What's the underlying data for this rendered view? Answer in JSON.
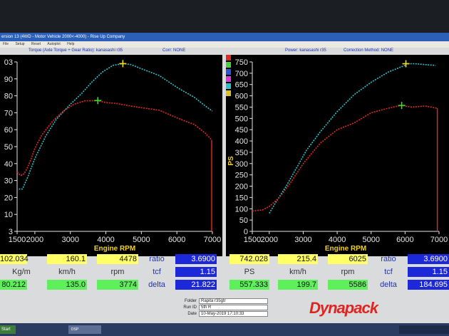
{
  "window": {
    "title": "ersion 13 (4WD - Motor Vehicle 2000<-4000) - Rise Up Company"
  },
  "menu": [
    "File",
    "Setup",
    "Reset",
    "Autoplot",
    "Help"
  ],
  "left_header": {
    "title": "Torque (Axle Torque + Gear Ratio): kanasashi r35",
    "corr": "Corr: NONE"
  },
  "right_header": {
    "title": "Power: kanasashi r35",
    "corr": "Correction Method: NONE"
  },
  "colors": {
    "red_curve": "#e02a24",
    "cyan_curve": "#2fbfc8",
    "marker_yellow": "#f4e214",
    "marker_green": "#38e21f"
  },
  "chart_data": [
    {
      "type": "line",
      "xlabel": "Engine RPM",
      "ylabel": "",
      "x_ticks": [
        "1500",
        "2000",
        "3000",
        "4000",
        "5000",
        "6000",
        "7000"
      ],
      "y_ticks": [
        "3",
        "10",
        "20",
        "30",
        "40",
        "50",
        "60",
        "70",
        "80",
        "90",
        "03"
      ],
      "xlim": [
        1500,
        7000
      ],
      "ylim": [
        3,
        103
      ],
      "series": [
        {
          "color": "cyan",
          "x": [
            1550,
            1650,
            1800,
            2000,
            2300,
            2600,
            3000,
            3300,
            3600,
            3900,
            4200,
            4478,
            4700,
            5000,
            5500,
            6000,
            6500,
            6800,
            7000
          ],
          "y": [
            28,
            28,
            35,
            46,
            59,
            69,
            78,
            84,
            91,
            97,
            101,
            102,
            101.5,
            99,
            95,
            88,
            82,
            77,
            74
          ]
        },
        {
          "color": "red",
          "x": [
            1500,
            1600,
            1700,
            1800,
            1900,
            2000,
            2200,
            2500,
            2800,
            3100,
            3400,
            3774,
            4000,
            4300,
            4700,
            5000,
            5500,
            6000,
            6500,
            6800,
            6980
          ],
          "y": [
            38,
            36,
            37,
            41,
            46,
            52,
            60,
            68,
            74,
            78,
            80,
            80.2,
            79,
            78.5,
            77,
            76,
            74.5,
            70,
            66,
            61,
            57
          ]
        }
      ],
      "markers": [
        {
          "color": "yellow",
          "x": 4478,
          "y": 102.0
        },
        {
          "color": "green",
          "x": 3774,
          "y": 80.2
        }
      ]
    },
    {
      "type": "line",
      "xlabel": "Engine RPM",
      "ylabel": "PS",
      "x_ticks": [
        "1500",
        "2000",
        "3000",
        "4000",
        "5000",
        "6000",
        "7000"
      ],
      "y_ticks": [
        "0",
        "50",
        "100",
        "150",
        "200",
        "250",
        "300",
        "350",
        "400",
        "450",
        "500",
        "550",
        "600",
        "650",
        "700",
        "750"
      ],
      "xlim": [
        1500,
        7000
      ],
      "ylim": [
        0,
        750
      ],
      "series": [
        {
          "color": "cyan",
          "x": [
            2000,
            2200,
            2500,
            2800,
            3100,
            3500,
            4000,
            4500,
            5000,
            5500,
            6000,
            6025,
            6300,
            6600,
            6900
          ],
          "y": [
            80,
            130,
            200,
            280,
            360,
            440,
            530,
            605,
            660,
            705,
            735,
            742,
            742,
            738,
            735
          ]
        },
        {
          "color": "red",
          "x": [
            1500,
            1800,
            2000,
            2300,
            2600,
            3000,
            3500,
            4000,
            4500,
            5000,
            5500,
            5800,
            5900,
            6200,
            6600,
            6950
          ],
          "y": [
            90,
            95,
            110,
            150,
            210,
            300,
            390,
            450,
            480,
            525,
            545,
            555,
            557,
            550,
            555,
            545
          ]
        }
      ],
      "markers": [
        {
          "color": "yellow",
          "x": 6025,
          "y": 742.0
        },
        {
          "color": "green",
          "x": 5900,
          "y": 557.3
        }
      ]
    }
  ],
  "readouts": {
    "left": {
      "top": [
        "102.034",
        "160.1",
        "4478"
      ],
      "units": [
        "Kg/m",
        "km/h",
        "rpm"
      ],
      "bottom": [
        "80.212",
        "135.0",
        "3774"
      ],
      "ratio_label": "ratio",
      "ratio": "3.6900",
      "tcf_label": "tcf",
      "tcf": "1.15",
      "delta_label": "delta",
      "delta": "21.822"
    },
    "right": {
      "top": [
        "742.028",
        "215.4",
        "6025"
      ],
      "units": [
        "PS",
        "km/h",
        "rpm"
      ],
      "bottom": [
        "557.333",
        "199.7",
        "5586"
      ],
      "ratio_label": "ratio",
      "ratio": "3.6900",
      "tcf_label": "tcf",
      "tcf": "1.15",
      "delta_label": "delta",
      "delta": "184.695"
    }
  },
  "info": {
    "folder_label": "Folder",
    "folder": "Rapita r35gtr",
    "runid_label": "Run ID",
    "runid": "5th R",
    "date_label": "Date",
    "date": "10-May-2019 17:10:33"
  },
  "logo": "Dynapack",
  "taskbar": {
    "start": "Start",
    "task": "DSP"
  }
}
